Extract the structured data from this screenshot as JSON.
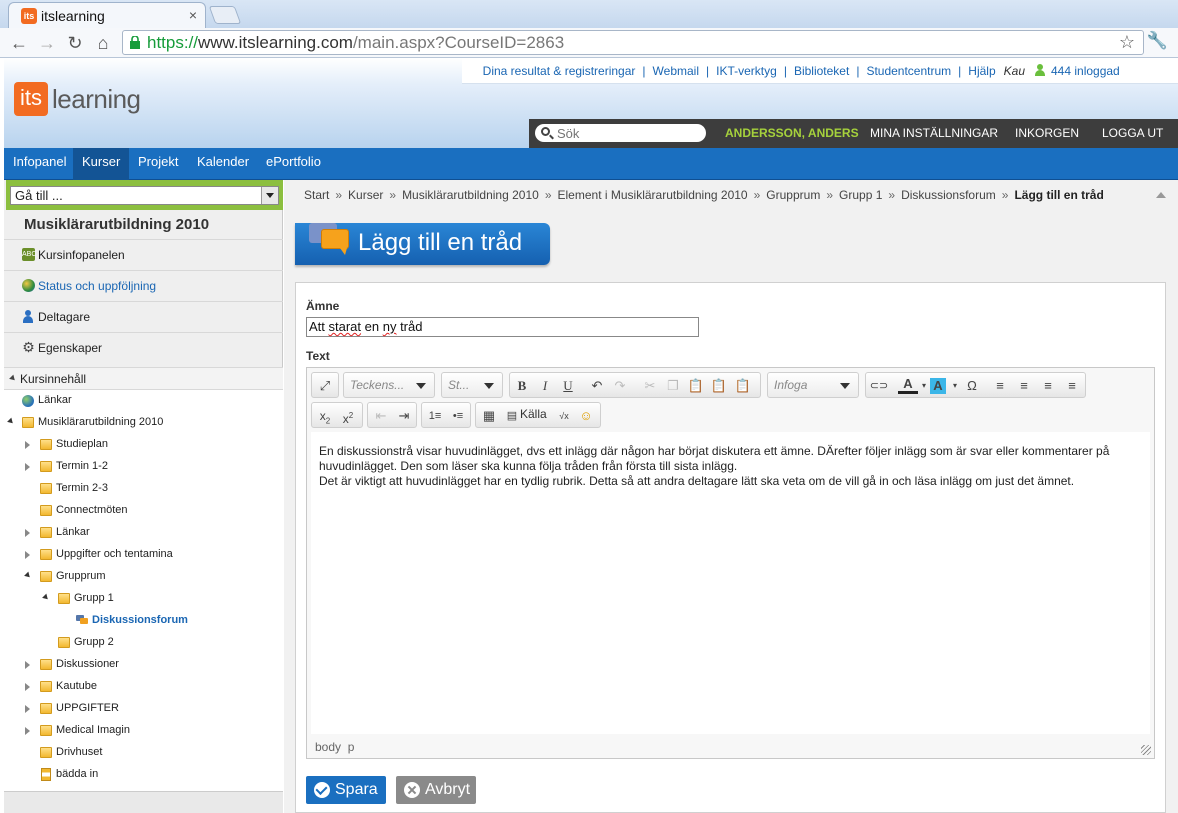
{
  "browser": {
    "tab_title": "itslearning",
    "tab_icon": "itslearning-favicon",
    "url_scheme": "https://",
    "url_host": "www.itslearning.com",
    "url_path": "/main.aspx?CourseID=2863"
  },
  "header": {
    "logo_box": "its",
    "logo_text": "learning",
    "toplinks": [
      "Dina resultat & registreringar",
      "Webmail",
      "IKT-verktyg",
      "Biblioteket",
      "Studentcentrum",
      "Hjälp"
    ],
    "institution": "Kau",
    "online_count": "444 inloggad",
    "search_placeholder": "Sök",
    "user_name": "ANDERSSON, ANDERS",
    "settings_label": "MINA INSTÄLLNINGAR",
    "inbox_label": "INKORGEN",
    "logout_label": "LOGGA UT"
  },
  "mainnav": [
    "Infopanel",
    "Kurser",
    "Projekt",
    "Kalender",
    "ePortfolio"
  ],
  "left": {
    "goto_value": "Gå till ...",
    "course_title": "Musiklärarutbildning 2010",
    "menu": [
      "Kursinfopanelen",
      "Status och uppföljning",
      "Deltagare",
      "Egenskaper"
    ],
    "section": "Kursinnehåll",
    "tree": [
      {
        "label": "Länkar"
      },
      {
        "label": "Musiklärarutbildning 2010"
      },
      {
        "label": "Studieplan"
      },
      {
        "label": "Termin 1-2"
      },
      {
        "label": "Termin 2-3"
      },
      {
        "label": "Connectmöten"
      },
      {
        "label": "Länkar"
      },
      {
        "label": "Uppgifter och tentamina"
      },
      {
        "label": "Grupprum"
      },
      {
        "label": "Grupp 1"
      },
      {
        "label": "Diskussionsforum"
      },
      {
        "label": "Grupp 2"
      },
      {
        "label": "Diskussioner"
      },
      {
        "label": "Kautube"
      },
      {
        "label": "UPPGIFTER"
      },
      {
        "label": "Medical Imagin"
      },
      {
        "label": "Drivhuset"
      },
      {
        "label": "bädda in"
      }
    ]
  },
  "breadcrumb": [
    "Start",
    "Kurser",
    "Musiklärarutbildning 2010",
    "Element i Musiklärarutbildning 2010",
    "Grupprum",
    "Grupp 1",
    "Diskussionsforum",
    "Lägg till en tråd"
  ],
  "page": {
    "title": "Lägg till en tråd",
    "subject_label": "Ämne",
    "subject_value": [
      "Att ",
      "starat",
      " en ",
      "ny",
      " tråd"
    ],
    "text_label": "Text",
    "font_placeholder": "Teckens...",
    "size_placeholder": "St...",
    "insert_placeholder": "Infoga",
    "source_label": "Källa",
    "body_lines": [
      "En diskussionstrå visar huvudinlägget, dvs ett inlägg där någon har börjat diskutera ett ämne. DÄrefter följer inlägg som är svar eller kommentarer på huvudinlägget. Den som läser ska kunna följa tråden från första till sista inlägg.",
      "Det är viktigt att huvudinlägget har en tydlig rubrik. Detta så att andra deltagare lätt ska veta om de vill gå in och läsa inlägg om just det ämnet."
    ],
    "status_path": [
      "body",
      "p"
    ],
    "save_label": "Spara",
    "cancel_label": "Avbryt"
  },
  "colors": {
    "brand_orange": "#f26b21",
    "nav_blue": "#1a6fc0",
    "user_green": "#a6d23c",
    "goto_green": "#8cbf3f"
  }
}
